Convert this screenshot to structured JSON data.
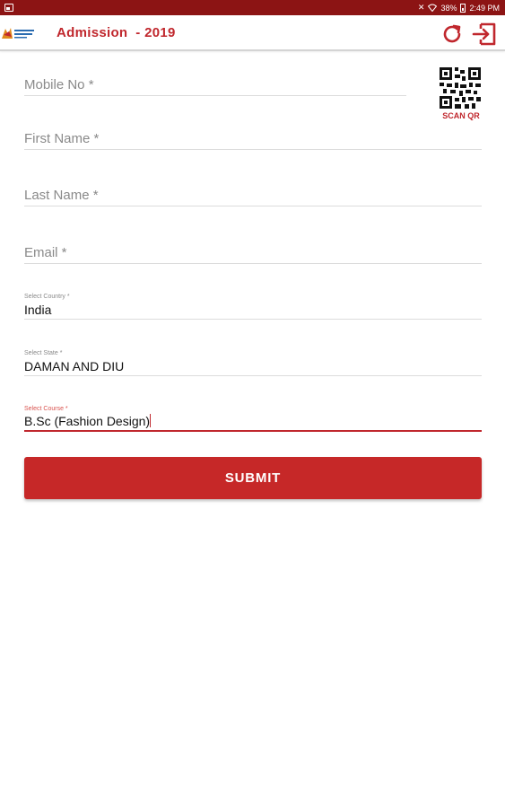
{
  "status_bar": {
    "battery": "38%",
    "time": "2:49 PM",
    "icons": [
      "image-icon",
      "mute-icon",
      "wifi-icon",
      "battery-icon"
    ]
  },
  "app_bar": {
    "title": "Admission  - 2019",
    "logo_icon": "college-logo-icon",
    "refresh_icon": "refresh-icon",
    "exit_icon": "exit-icon"
  },
  "form": {
    "mobile": {
      "placeholder": "Mobile No *",
      "value": ""
    },
    "scan_qr": {
      "label": "SCAN QR",
      "icon": "qr-code-icon"
    },
    "first_name": {
      "placeholder": "First Name *",
      "value": ""
    },
    "last_name": {
      "placeholder": "Last Name *",
      "value": ""
    },
    "email": {
      "placeholder": "Email *",
      "value": ""
    },
    "country": {
      "label": "Select Country *",
      "value": "India"
    },
    "state": {
      "label": "Select State *",
      "value": "DAMAN AND DIU"
    },
    "course": {
      "label": "Select Course *",
      "value": "B.Sc (Fashion Design)"
    },
    "submit_label": "SUBMIT"
  },
  "colors": {
    "status_bar": "#8c1414",
    "accent": "#c0272d",
    "button": "#c62828"
  }
}
